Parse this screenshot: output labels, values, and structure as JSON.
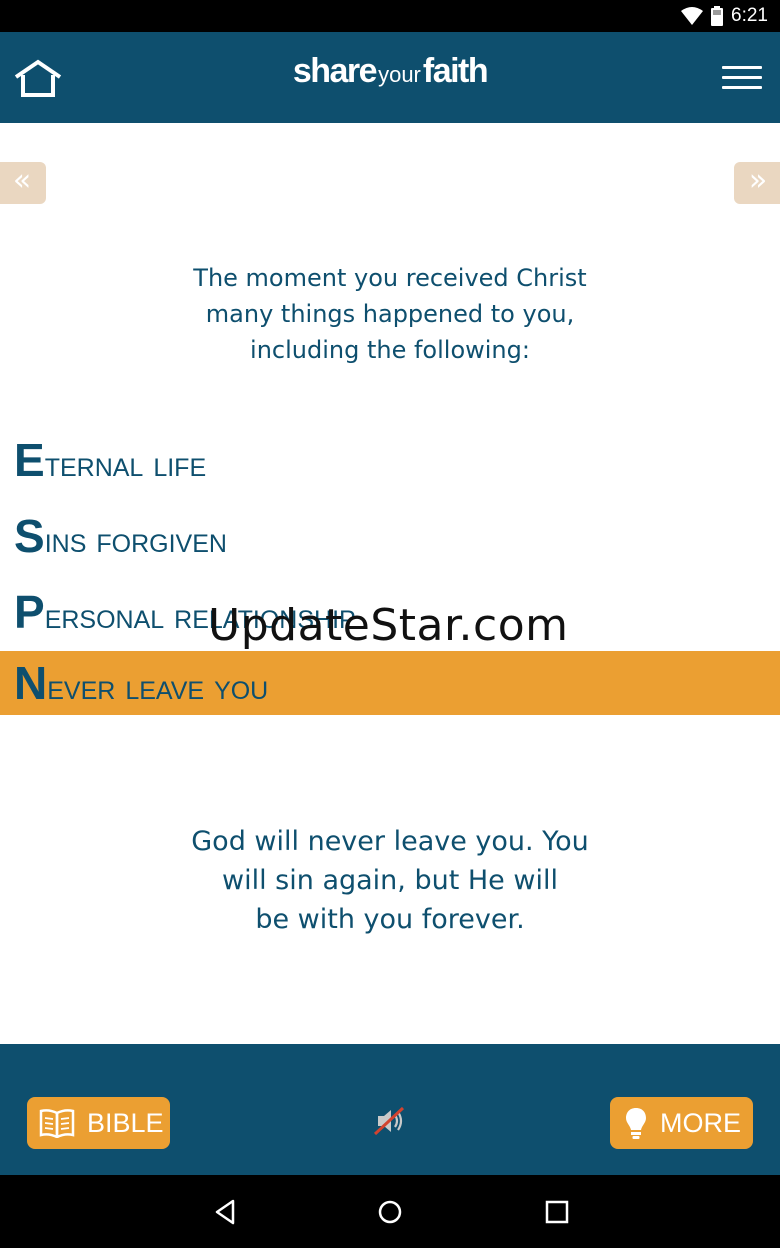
{
  "status_bar": {
    "time": "6:21",
    "icons": [
      "wifi-icon",
      "battery-icon"
    ]
  },
  "header": {
    "logo_part1": "share",
    "logo_part2": "your",
    "logo_part3": "faith",
    "icons": [
      "home-icon",
      "menu-icon"
    ]
  },
  "navigation": {
    "prev_label": "«",
    "next_label": "»"
  },
  "intro": {
    "lines": [
      "The moment you received Christ",
      "many things happened to you,",
      "including the following:"
    ]
  },
  "acrostic": [
    {
      "initial": "E",
      "rest": "ternal life",
      "active": false
    },
    {
      "initial": "S",
      "rest": "ins forgiven",
      "active": false
    },
    {
      "initial": "P",
      "rest": "ersonal relationship",
      "active": false
    },
    {
      "initial": "N",
      "rest": "ever leave you",
      "active": true
    }
  ],
  "watermark": "UpdateStar.com",
  "detail": {
    "lines": [
      "God will never leave you. You",
      "will sin again, but He will",
      "be with you forever."
    ]
  },
  "footer": {
    "bible_label": "BIBLE",
    "more_label": "MORE",
    "icons": [
      "book-icon",
      "sound-muted-icon",
      "lightbulb-icon"
    ]
  },
  "colors": {
    "brand_blue": "#0e4f6e",
    "accent_orange": "#eb9f32",
    "arrow_tan": "#ead7c1"
  }
}
